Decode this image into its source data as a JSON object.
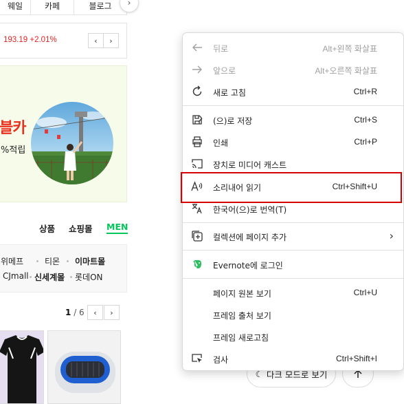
{
  "top_tabs": [
    "웨일",
    "카페",
    "블로그"
  ],
  "stock": {
    "text": "193.19 +2.01%"
  },
  "banner": {
    "title": "블카",
    "subtitle": "%적립"
  },
  "shopping_tabs": [
    "상품",
    "쇼핑몰",
    "MEN"
  ],
  "malls_row1": [
    "위메프",
    "티몬",
    "이마트몰"
  ],
  "malls_row2": [
    "CJmall",
    "신세계몰",
    "롯데ON"
  ],
  "pagination": {
    "current": "1",
    "total": "/ 6"
  },
  "bottom_buttons": {
    "dark_mode": "다크 모드로 보기"
  },
  "context_menu": {
    "items": [
      {
        "label": "뒤로",
        "shortcut": "Alt+왼쪽 화살표",
        "icon": "back-arrow-icon",
        "disabled": true
      },
      {
        "label": "앞으로",
        "shortcut": "Alt+오른쪽 화살표",
        "icon": "forward-arrow-icon",
        "disabled": true
      },
      {
        "label": "새로 고침",
        "shortcut": "Ctrl+R",
        "icon": "refresh-icon",
        "disabled": false
      },
      {
        "label": "(으)로 저장",
        "shortcut": "Ctrl+S",
        "icon": "save-as-icon",
        "disabled": false
      },
      {
        "label": "인쇄",
        "shortcut": "Ctrl+P",
        "icon": "print-icon",
        "disabled": false
      },
      {
        "label": "장치로 미디어 캐스트",
        "shortcut": "",
        "icon": "cast-icon",
        "disabled": false
      },
      {
        "label": "소리내어 읽기",
        "shortcut": "Ctrl+Shift+U",
        "icon": "read-aloud-icon",
        "disabled": false
      },
      {
        "label": "한국어(으)로 번역(T)",
        "shortcut": "",
        "icon": "translate-icon",
        "disabled": false
      },
      {
        "label": "컬렉션에 페이지 추가",
        "shortcut": "",
        "icon": "collections-icon",
        "disabled": false
      },
      {
        "label": "Evernote에 로그인",
        "shortcut": "",
        "icon": "evernote-icon",
        "disabled": false
      },
      {
        "label": "페이지 원본 보기",
        "shortcut": "Ctrl+U",
        "icon": "",
        "disabled": false
      },
      {
        "label": "프레임 출처 보기",
        "shortcut": "",
        "icon": "",
        "disabled": false
      },
      {
        "label": "프레임 새로고침",
        "shortcut": "",
        "icon": "",
        "disabled": false
      },
      {
        "label": "검사",
        "shortcut": "Ctrl+Shift+I",
        "icon": "inspect-icon",
        "disabled": false
      }
    ]
  },
  "colors": {
    "stock_up": "#e02424",
    "accent_green": "#03c75a",
    "highlight": "#d60000",
    "evernote": "#2dbe60"
  }
}
